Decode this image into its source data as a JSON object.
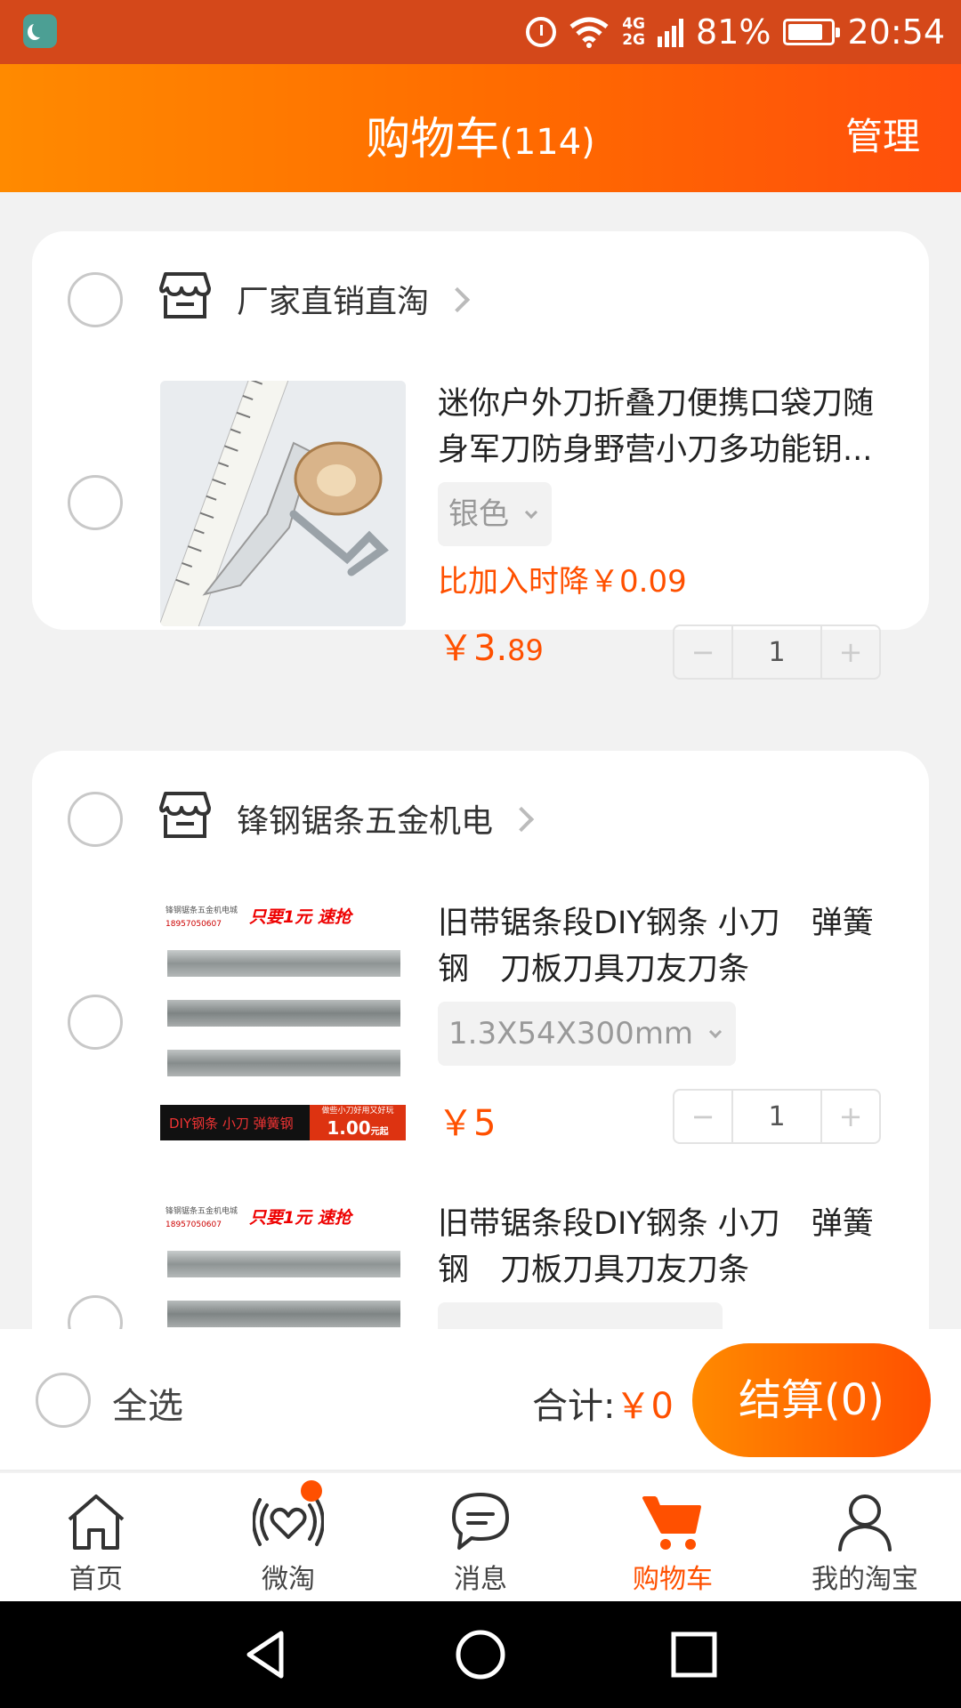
{
  "status_bar": {
    "network_type_top": "4G",
    "network_type_bottom": "2G",
    "battery_percent": "81%",
    "time": "20:54"
  },
  "header": {
    "title": "购物车",
    "count": "(114)",
    "manage_label": "管理"
  },
  "shops": [
    {
      "name": "厂家直销直淘",
      "items": [
        {
          "title": "迷你户外刀折叠刀便携口袋刀随身军刀防身野营小刀多功能钥...",
          "sku": "银色",
          "price_drop": "比加入时降￥0.09",
          "price_symbol": "￥",
          "price_int": "3.",
          "price_dec": "89",
          "quantity": "1"
        }
      ]
    },
    {
      "name": "锋钢锯条五金机电",
      "items": [
        {
          "title": "旧带锯条段DIY钢条 小刀　弹簧钢　刀板刀具刀友刀条",
          "sku": "1.3X54X300mm",
          "price_symbol": "￥",
          "price_int": "5",
          "quantity": "1",
          "image_text_top": "只要1元 速抢",
          "image_text_shop": "锋钢锯条五金机电城",
          "image_text_phone": "18957050607",
          "image_text_bottom": "DIY钢条 小刀 弹簧钢",
          "image_text_promo": "做些小刀好用又好玩",
          "image_text_price": "1.00",
          "image_text_unit": "元起"
        },
        {
          "title": "旧带锯条段DIY钢条 小刀　弹簧钢　刀板刀具刀友刀条",
          "image_text_top": "只要1元 速抢",
          "image_text_shop": "锋钢锯条五金机电城",
          "image_text_phone": "18957050607"
        }
      ]
    }
  ],
  "action_bar": {
    "select_all_label": "全选",
    "total_label": "合计:",
    "total_amount": "￥0",
    "checkout_label": "结算(0)"
  },
  "tab_bar": {
    "tabs": [
      {
        "label": "首页",
        "icon": "home-icon"
      },
      {
        "label": "微淘",
        "icon": "weitao-heart-icon"
      },
      {
        "label": "消息",
        "icon": "message-icon"
      },
      {
        "label": "购物车",
        "icon": "cart-icon"
      },
      {
        "label": "我的淘宝",
        "icon": "profile-icon"
      }
    ],
    "active_index": 3
  },
  "colors": {
    "accent": "#ff5000",
    "header_gradient_start": "#ff8a00",
    "header_gradient_end": "#ff4e0c",
    "status_bar": "#d4481a"
  }
}
